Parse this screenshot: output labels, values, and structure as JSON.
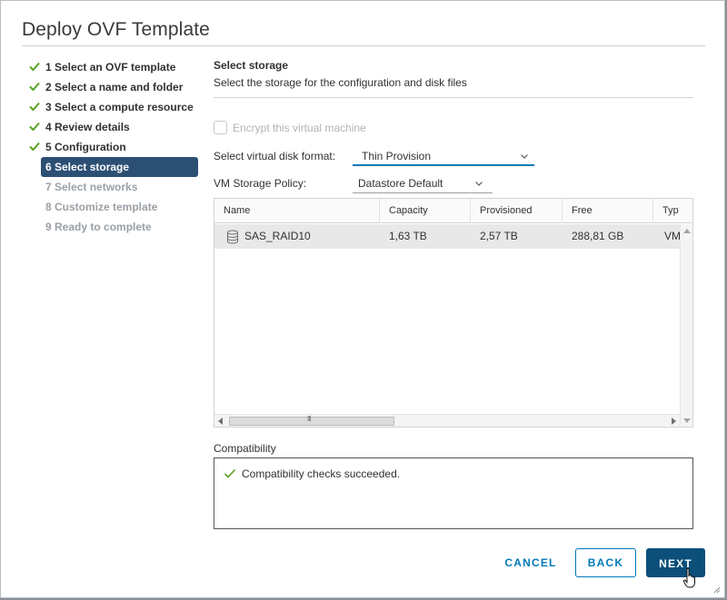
{
  "dialog": {
    "title": "Deploy OVF Template"
  },
  "steps": [
    {
      "label": "1 Select an OVF template",
      "state": "done"
    },
    {
      "label": "2 Select a name and folder",
      "state": "done"
    },
    {
      "label": "3 Select a compute resource",
      "state": "done"
    },
    {
      "label": "4 Review details",
      "state": "done"
    },
    {
      "label": "5 Configuration",
      "state": "done"
    },
    {
      "label": "6 Select storage",
      "state": "active"
    },
    {
      "label": "7 Select networks",
      "state": "disabled"
    },
    {
      "label": "8 Customize template",
      "state": "disabled"
    },
    {
      "label": "9 Ready to complete",
      "state": "disabled"
    }
  ],
  "main": {
    "title": "Select storage",
    "subtitle": "Select the storage for the configuration and disk files",
    "encrypt_label": "Encrypt this virtual machine",
    "disk_format_label": "Select virtual disk format:",
    "disk_format_value": "Thin Provision",
    "storage_policy_label": "VM Storage Policy:",
    "storage_policy_value": "Datastore Default"
  },
  "table": {
    "columns": [
      "Name",
      "Capacity",
      "Provisioned",
      "Free",
      "Typ"
    ],
    "rows": [
      {
        "name": "SAS_RAID10",
        "capacity": "1,63 TB",
        "provisioned": "2,57 TB",
        "free": "288,81 GB",
        "type": "VM"
      }
    ],
    "scroll_grip": "III"
  },
  "compatibility": {
    "label": "Compatibility",
    "message": "Compatibility checks succeeded."
  },
  "footer": {
    "cancel_label": "CANCEL",
    "back_label": "BACK",
    "next_label": "NEXT"
  },
  "colors": {
    "accent": "#0079b8",
    "active_step": "#2c4f74",
    "success": "#5aa220",
    "primary_button": "#0b4f7a"
  }
}
